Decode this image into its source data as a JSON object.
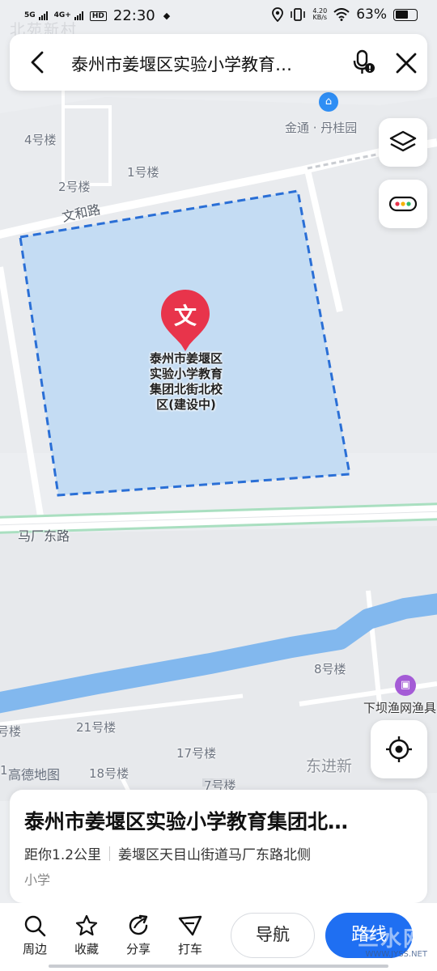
{
  "status_bar": {
    "network1": "5G",
    "network2": "4G+",
    "hd": "HD",
    "time": "22:30",
    "speed_value": "4.20",
    "speed_unit": "KB/s",
    "battery": "63%"
  },
  "watermark_top": "北苑新村",
  "search": {
    "title": "泰州市姜堰区实验小学教育…"
  },
  "map": {
    "labels": {
      "jintong": "金通 · 丹桂园",
      "b4": "4号楼",
      "b2": "2号楼",
      "b1": "1号楼",
      "wenhe": "文和路",
      "machang": "马厂东路",
      "b8": "8号楼",
      "xiaba": "下坝渔网渔具",
      "b21": "21号楼",
      "b17": "17号楼",
      "b18": "18号楼",
      "b7": "7号楼",
      "dongjin": "东进新",
      "leftlou": "号楼",
      "num": "1"
    },
    "poi": {
      "marker_glyph": "文",
      "name_lines": [
        "泰州市姜堰区",
        "实验小学教育",
        "集团北街北校",
        "区(建设中)"
      ]
    },
    "logo": "高德地图"
  },
  "card": {
    "name": "泰州市姜堰区实验小学教育集团北…",
    "distance": "距你1.2公里",
    "address": "姜堰区天目山街道马厂东路北侧",
    "category": "小学"
  },
  "toolbar": {
    "nearby": "周边",
    "favorite": "收藏",
    "share": "分享",
    "taxi": "打车",
    "navigate": "导航",
    "route": "路线"
  },
  "watermark_br": {
    "text": "三水网",
    "url": "WWW.JYSS.NET"
  },
  "colors": {
    "accent": "#1f6ff2",
    "marker": "#e8344b",
    "area_fill": "#c4dcf3",
    "area_border": "#2a6fd6",
    "river": "#82b8ee",
    "road_green": "#a9dfc0"
  }
}
